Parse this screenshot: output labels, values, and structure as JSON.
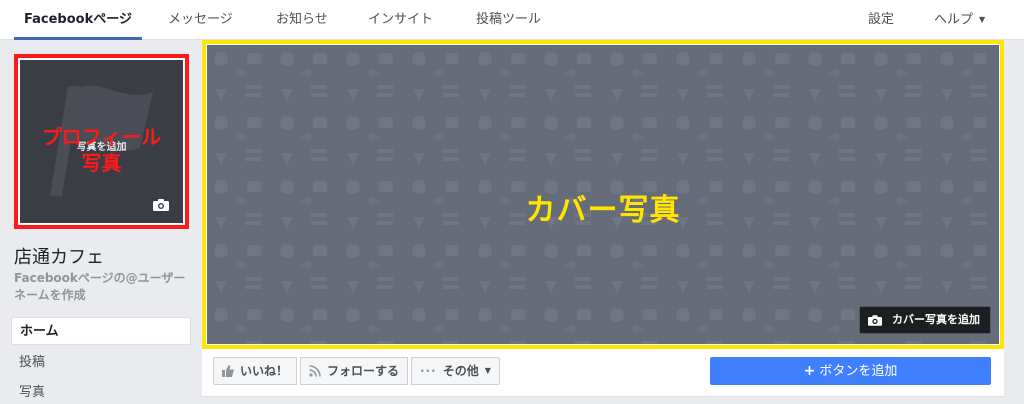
{
  "topnav": {
    "tabs": [
      {
        "label": "Facebookページ"
      },
      {
        "label": "メッセージ"
      },
      {
        "label": "お知らせ"
      },
      {
        "label": "インサイト"
      },
      {
        "label": "投稿ツール"
      }
    ],
    "settings_label": "設定",
    "help_label": "ヘルプ",
    "accent_color": "#4267b2"
  },
  "profile": {
    "add_photo_label": "写真を追加",
    "annotation_label_line1": "プロフィール",
    "annotation_label_line2": "写真",
    "annotation_color": "#ff1a1a",
    "icon": "camera-icon"
  },
  "page": {
    "name": "店通カフェ",
    "username_prompt": "Facebookページの@ユーザーネームを作成"
  },
  "left_menu": {
    "items": [
      {
        "label": "ホーム"
      },
      {
        "label": "投稿"
      },
      {
        "label": "写真"
      }
    ]
  },
  "cover": {
    "annotation_label": "カバー写真",
    "annotation_color": "#ffe600",
    "add_cover_label": "カバー写真を追加",
    "icon": "camera-icon"
  },
  "actions": {
    "like_label": "いいね！",
    "follow_label": "フォローする",
    "more_label": "その他",
    "add_button_label": "ボタンを追加",
    "add_button_color": "#4080ff"
  }
}
